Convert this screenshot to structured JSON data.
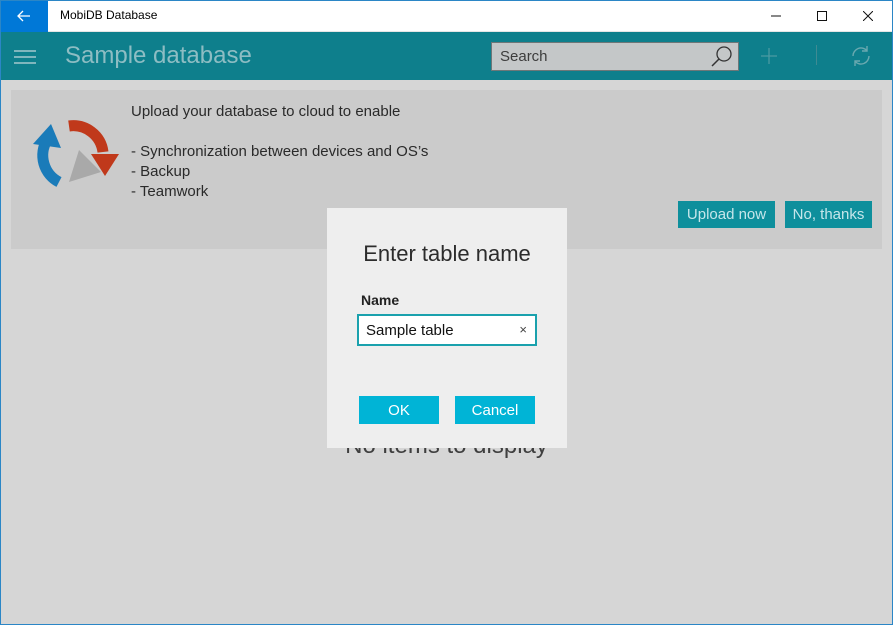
{
  "window": {
    "title": "MobiDB Database"
  },
  "appbar": {
    "title": "Sample database",
    "search_placeholder": "Search"
  },
  "banner": {
    "heading": "Upload your database to cloud to enable",
    "items": [
      "- Synchronization between devices and OS’s",
      "- Backup",
      "- Teamwork"
    ],
    "upload_label": "Upload now",
    "dismiss_label": "No, thanks"
  },
  "empty": {
    "text": "No items to display"
  },
  "dialog": {
    "title": "Enter table name",
    "name_label": "Name",
    "name_value": "Sample table",
    "ok_label": "OK",
    "cancel_label": "Cancel"
  },
  "colors": {
    "accent": "#0e7f8c",
    "dialog_button": "#00b4d6",
    "logo_blue": "#1a7bb9",
    "logo_red": "#c0391b"
  }
}
